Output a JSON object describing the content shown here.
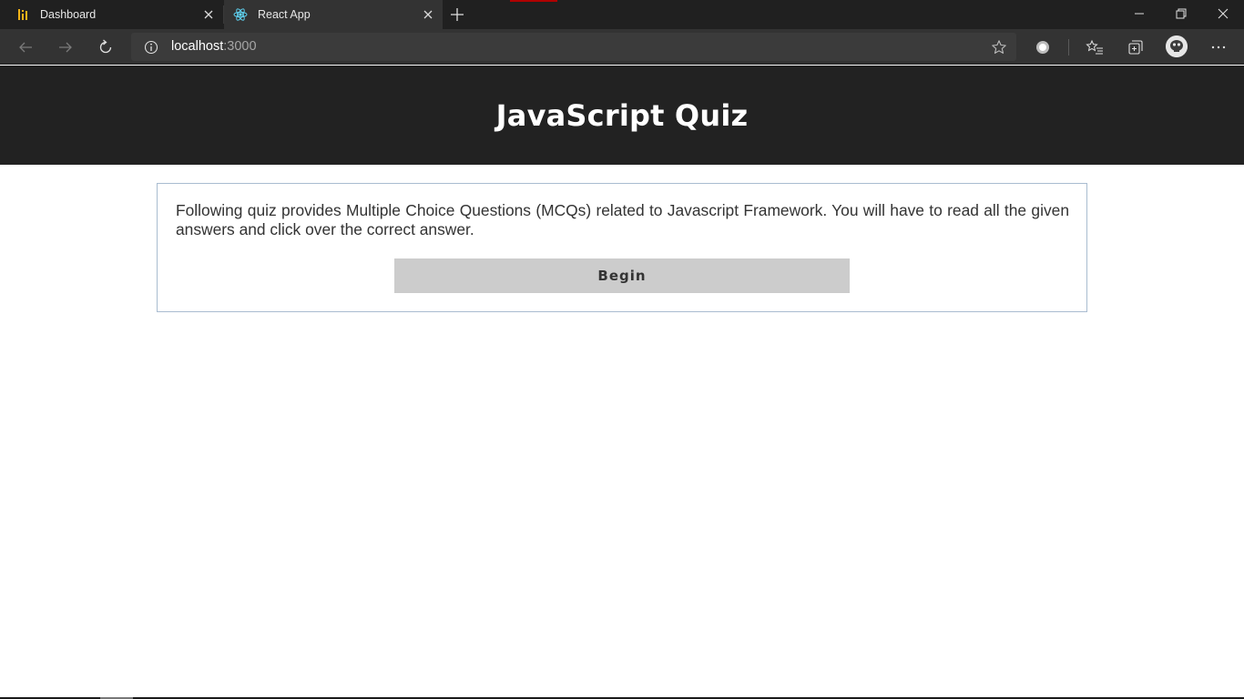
{
  "tabs": [
    {
      "title": "Dashboard",
      "icon": "dashboard-bars-icon",
      "active": false
    },
    {
      "title": "React App",
      "icon": "react-logo-icon",
      "active": true
    }
  ],
  "address_bar": {
    "host": "localhost",
    "port": ":3000"
  },
  "page": {
    "title": "JavaScript Quiz",
    "description": "Following quiz provides Multiple Choice Questions (MCQs) related to Javascript Framework. You will have to read all the given answers and click over the correct answer.",
    "begin_label": "Begin"
  },
  "colors": {
    "browser_frame": "#202020",
    "active_tab": "#333333",
    "page_header": "#222222",
    "button": "#cccccc",
    "card_border": "#a9bcd0",
    "react_logo": "#61dafb"
  }
}
